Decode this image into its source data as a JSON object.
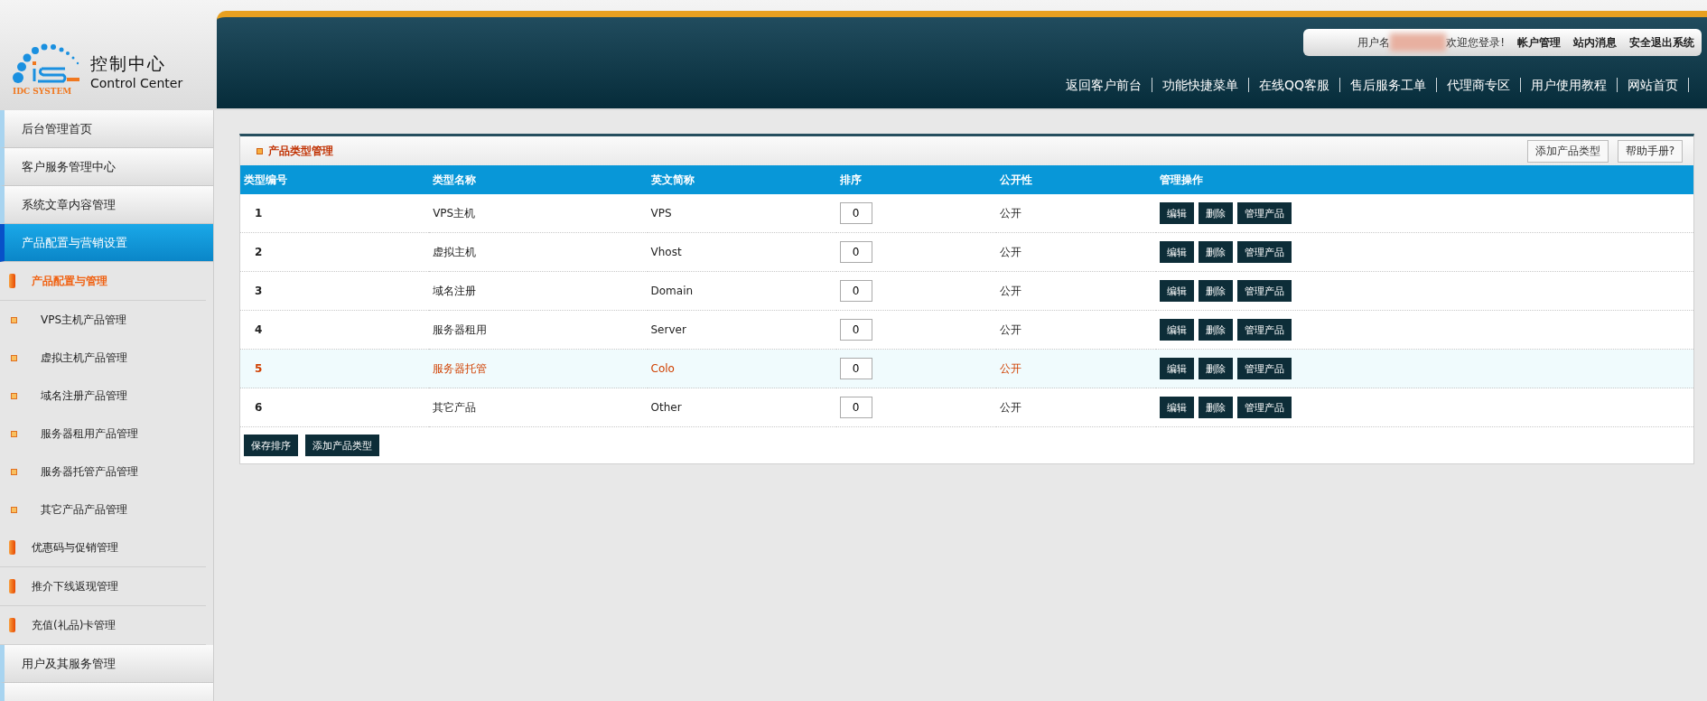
{
  "logo": {
    "mark": "IDC SYSTEM",
    "title": "控制中心",
    "subtitle": "Control Center"
  },
  "user_bar": {
    "user_label": "用户名",
    "welcome": "欢迎您登录!",
    "links": [
      "帐户管理",
      "站内消息",
      "安全退出系统"
    ]
  },
  "nav": [
    "返回客户前台",
    "功能快捷菜单",
    "在线QQ客服",
    "售后服务工单",
    "代理商专区",
    "用户使用教程",
    "网站首页"
  ],
  "sidebar": {
    "items": [
      {
        "label": "后台管理首页",
        "kind": "section",
        "selected": false
      },
      {
        "label": "客户服务管理中心",
        "kind": "section",
        "selected": false
      },
      {
        "label": "系统文章内容管理",
        "kind": "section",
        "selected": false
      },
      {
        "label": "产品配置与营销设置",
        "kind": "section",
        "selected": true,
        "children": [
          {
            "label": "产品配置与管理",
            "kind": "group",
            "selected": true,
            "children": [
              {
                "label": "VPS主机产品管理",
                "kind": "sub",
                "selected": false
              },
              {
                "label": "虚拟主机产品管理",
                "kind": "sub",
                "selected": false
              },
              {
                "label": "域名注册产品管理",
                "kind": "sub",
                "selected": false
              },
              {
                "label": "服务器租用产品管理",
                "kind": "sub",
                "selected": false
              },
              {
                "label": "服务器托管产品管理",
                "kind": "sub",
                "selected": false
              },
              {
                "label": "其它产品产品管理",
                "kind": "sub",
                "selected": false
              }
            ]
          },
          {
            "label": "优惠码与促销管理",
            "kind": "group",
            "selected": false
          },
          {
            "label": "推介下线返现管理",
            "kind": "group",
            "selected": false
          },
          {
            "label": "充值(礼品)卡管理",
            "kind": "group",
            "selected": false
          }
        ]
      },
      {
        "label": "用户及其服务管理",
        "kind": "section",
        "selected": false
      }
    ]
  },
  "panel": {
    "title": "产品类型管理",
    "buttons": [
      "添加产品类型",
      "帮助手册?"
    ],
    "table": {
      "columns": [
        "类型编号",
        "类型名称",
        "英文简称",
        "排序",
        "公开性",
        "管理操作"
      ],
      "rows": [
        {
          "id": "1",
          "name": "VPS主机",
          "short": "VPS",
          "order": "0",
          "visibility": "公开",
          "selected": false,
          "actions": [
            "编辑",
            "删除",
            "管理产品"
          ]
        },
        {
          "id": "2",
          "name": "虚拟主机",
          "short": "Vhost",
          "order": "0",
          "visibility": "公开",
          "selected": false,
          "actions": [
            "编辑",
            "删除",
            "管理产品"
          ]
        },
        {
          "id": "3",
          "name": "域名注册",
          "short": "Domain",
          "order": "0",
          "visibility": "公开",
          "selected": false,
          "actions": [
            "编辑",
            "删除",
            "管理产品"
          ]
        },
        {
          "id": "4",
          "name": "服务器租用",
          "short": "Server",
          "order": "0",
          "visibility": "公开",
          "selected": false,
          "actions": [
            "编辑",
            "删除",
            "管理产品"
          ]
        },
        {
          "id": "5",
          "name": "服务器托管",
          "short": "Colo",
          "order": "0",
          "visibility": "公开",
          "selected": true,
          "actions": [
            "编辑",
            "删除",
            "管理产品"
          ]
        },
        {
          "id": "6",
          "name": "其它产品",
          "short": "Other",
          "order": "0",
          "visibility": "公开",
          "selected": false,
          "actions": [
            "编辑",
            "删除",
            "管理产品"
          ]
        }
      ]
    },
    "footer_buttons": [
      "保存排序",
      "添加产品类型"
    ]
  }
}
